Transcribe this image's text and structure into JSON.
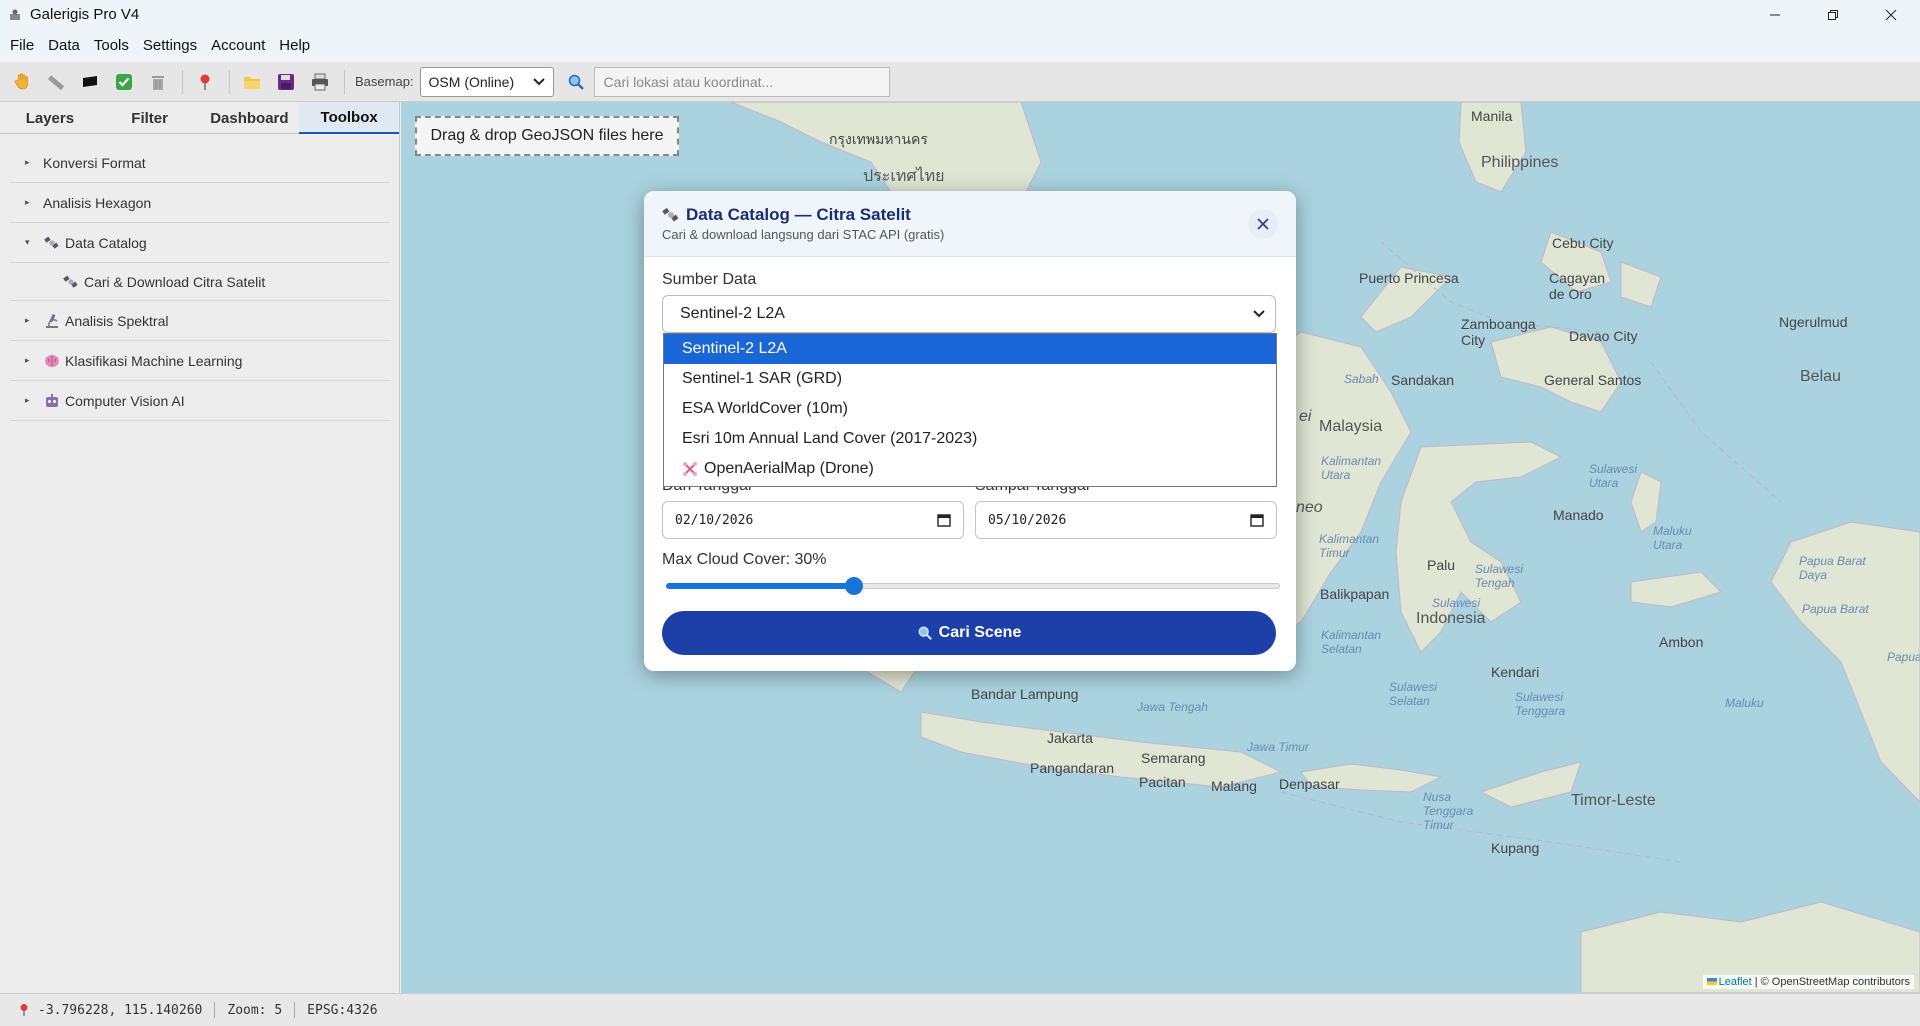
{
  "window": {
    "title": "Galerigis Pro V4"
  },
  "menu": [
    "File",
    "Data",
    "Tools",
    "Settings",
    "Account",
    "Help"
  ],
  "toolbar": {
    "basemap_label": "Basemap:",
    "basemap_value": "OSM (Online)",
    "search_placeholder": "Cari lokasi atau koordinat..."
  },
  "sidebar": {
    "tabs": [
      "Layers",
      "Filter",
      "Dashboard",
      "Toolbox"
    ],
    "active_tab": "Toolbox",
    "items": [
      {
        "label": "Konversi Format",
        "expanded": false
      },
      {
        "label": "Analisis Hexagon",
        "expanded": false
      },
      {
        "label": "Data Catalog",
        "expanded": true,
        "icon": "satellite-icon"
      },
      {
        "label": "Cari & Download Citra Satelit",
        "child": true,
        "icon": "satellite-icon"
      },
      {
        "label": "Analisis Spektral",
        "expanded": false,
        "icon": "microscope-icon"
      },
      {
        "label": "Klasifikasi Machine Learning",
        "expanded": false,
        "icon": "brain-icon"
      },
      {
        "label": "Computer Vision AI",
        "expanded": false,
        "icon": "robot-icon"
      }
    ]
  },
  "map": {
    "dropzone": "Drag & drop GeoJSON files here",
    "attribution_leaflet": "Leaflet",
    "attribution_rest": " | © OpenStreetMap contributors",
    "labels": {
      "manila": "Manila",
      "bangkok": "กรุงเทพมหานคร",
      "thailand": "ประเทศไทย",
      "philippines": "Philippines",
      "cebu": "Cebu City",
      "puerto": "Puerto Princesa",
      "cagayan": "Cagayan de Oro",
      "zamboanga": "Zamboanga City",
      "davao": "Davao City",
      "ngerulmud": "Ngerulmud",
      "belau": "Belau",
      "sabah": "Sabah",
      "sandakan": "Sandakan",
      "gensan": "General Santos",
      "malaysia": "Malaysia",
      "kaltara": "Kalimantan Utara",
      "sulut": "Sulawesi Utara",
      "manado": "Manado",
      "malutara": "Maluku Utara",
      "pbd": "Papua Barat Daya",
      "pb": "Papua Barat",
      "kaltim": "Kalimantan Timur",
      "palu": "Palu",
      "sulteng": "Sulawesi Tengah",
      "balikpapan": "Balikpapan",
      "sulawesi": "Sulawesi",
      "indonesia": "Indonesia",
      "kalsel": "Kalimantan Selatan",
      "sulsel": "Sulawesi Selatan",
      "kendari": "Kendari",
      "sultra": "Sulawesi Tenggara",
      "ambon": "Ambon",
      "maluku": "Maluku",
      "papua": "Papua",
      "lampung": "Bandar Lampung",
      "jateng": "Jawa Tengah",
      "jatim": "Jawa Timur",
      "jakarta": "Jakarta",
      "semarang": "Semarang",
      "pangandaran": "Pangandaran",
      "pacitan": "Pacitan",
      "malang": "Malang",
      "denpasar": "Denpasar",
      "ntt": "Nusa Tenggara Timur",
      "timor": "Timor-Leste",
      "kupang": "Kupang",
      "neo": "neo",
      "ei": "ei"
    }
  },
  "modal": {
    "title": "Data Catalog — Citra Satelit",
    "subtitle": "Cari & download langsung dari STAC API (gratis)",
    "source_label": "Sumber Data",
    "source_value": "Sentinel-2 L2A",
    "source_options": [
      "Sentinel-2 L2A",
      "Sentinel-1 SAR (GRD)",
      "ESA WorldCover (10m)",
      "Esri 10m Annual Land Cover (2017-2023)",
      "OpenAerialMap (Drone)"
    ],
    "from_label": "Dari Tanggal",
    "to_label": "Sampai Tanggal",
    "from_date": "02/10/2026",
    "to_date": "05/10/2026",
    "cloud_label": "Max Cloud Cover: 30%",
    "cloud_value_percent": 30,
    "search_button": "Cari Scene"
  },
  "status": {
    "coords": "-3.796228, 115.140260",
    "zoom": "Zoom: 5",
    "epsg": "EPSG:4326"
  },
  "colors": {
    "accent": "#1d3fa8",
    "selected": "#1a66d6",
    "water": "#aad3df",
    "land": "#dfe6d4"
  }
}
